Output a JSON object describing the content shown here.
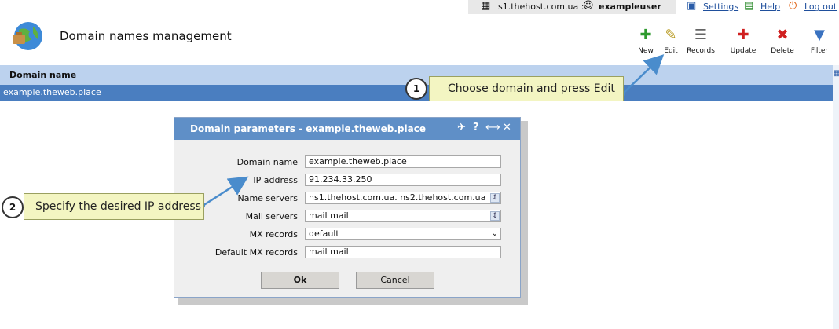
{
  "topbar": {
    "server": "s1.thehost.com.ua ::",
    "user": "exampleuser",
    "settings": "Settings",
    "help": "Help",
    "logout": "Log out"
  },
  "page": {
    "title": "Domain names management"
  },
  "toolbar": {
    "new": "New",
    "edit": "Edit",
    "records": "Records",
    "update": "Update",
    "delete": "Delete",
    "filter": "Filter"
  },
  "table": {
    "column": "Domain name",
    "rows": [
      "example.theweb.place"
    ]
  },
  "dialog": {
    "title": "Domain parameters - example.theweb.place",
    "fields": [
      {
        "label": "Domain name",
        "value": "example.theweb.place"
      },
      {
        "label": "IP address",
        "value": "91.234.33.250"
      },
      {
        "label": "Name servers",
        "value": "ns1.thehost.com.ua. ns2.thehost.com.ua"
      },
      {
        "label": "Mail servers",
        "value": "mail mail"
      },
      {
        "label": "MX records",
        "value": "default"
      },
      {
        "label": "Default MX records",
        "value": "mail mail"
      }
    ],
    "ok": "Ok",
    "cancel": "Cancel"
  },
  "callouts": [
    {
      "number": "1",
      "text": "Choose domain and press Edit"
    },
    {
      "number": "2",
      "text": "Specify the desired IP address"
    }
  ],
  "colors": {
    "header_row": "#bcd2ee",
    "selected_row": "#4a7ec0",
    "dialog_title": "#5f8fc7",
    "callout_bg": "#f3f5c2",
    "arrow": "#4a8ccc"
  }
}
